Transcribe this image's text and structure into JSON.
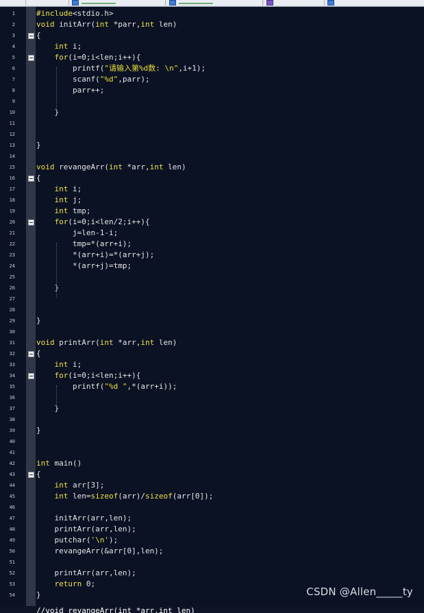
{
  "editor": {
    "lines": [
      {
        "n": "1",
        "text": "#include<stdio.h>",
        "fold": false
      },
      {
        "n": "2",
        "text": "void initArr(int *parr,int len)",
        "fold": false
      },
      {
        "n": "3",
        "text": "{",
        "fold": true
      },
      {
        "n": "4",
        "text": "    int i;",
        "fold": false
      },
      {
        "n": "5",
        "text": "    for(i=0;i<len;i++){",
        "fold": true
      },
      {
        "n": "6",
        "text": "        printf(\"请输入第%d数: \\n\",i+1);",
        "fold": false
      },
      {
        "n": "7",
        "text": "        scanf(\"%d\",parr);",
        "fold": false
      },
      {
        "n": "8",
        "text": "        parr++;",
        "fold": false
      },
      {
        "n": "9",
        "text": "",
        "fold": false
      },
      {
        "n": "10",
        "text": "    }",
        "fold": false
      },
      {
        "n": "11",
        "text": "",
        "fold": false
      },
      {
        "n": "12",
        "text": "",
        "fold": false
      },
      {
        "n": "13",
        "text": "}",
        "fold": false
      },
      {
        "n": "14",
        "text": "",
        "fold": false
      },
      {
        "n": "15",
        "text": "void revangeArr(int *arr,int len)",
        "fold": false
      },
      {
        "n": "16",
        "text": "{",
        "fold": true
      },
      {
        "n": "17",
        "text": "    int i;",
        "fold": false
      },
      {
        "n": "18",
        "text": "    int j;",
        "fold": false
      },
      {
        "n": "19",
        "text": "    int tmp;",
        "fold": false
      },
      {
        "n": "20",
        "text": "    for(i=0;i<len/2;i++){",
        "fold": true
      },
      {
        "n": "21",
        "text": "        j=len-1-i;",
        "fold": false
      },
      {
        "n": "22",
        "text": "        tmp=*(arr+i);",
        "fold": false
      },
      {
        "n": "23",
        "text": "        *(arr+i)=*(arr+j);",
        "fold": false
      },
      {
        "n": "24",
        "text": "        *(arr+j)=tmp;",
        "fold": false
      },
      {
        "n": "25",
        "text": "",
        "fold": false
      },
      {
        "n": "26",
        "text": "    }",
        "fold": false
      },
      {
        "n": "27",
        "text": "",
        "fold": false
      },
      {
        "n": "28",
        "text": "",
        "fold": false
      },
      {
        "n": "29",
        "text": "}",
        "fold": false
      },
      {
        "n": "30",
        "text": "",
        "fold": false
      },
      {
        "n": "31",
        "text": "void printArr(int *arr,int len)",
        "fold": false
      },
      {
        "n": "32",
        "text": "{",
        "fold": true
      },
      {
        "n": "33",
        "text": "    int i;",
        "fold": false
      },
      {
        "n": "34",
        "text": "    for(i=0;i<len;i++){",
        "fold": true
      },
      {
        "n": "35",
        "text": "        printf(\"%d \",*(arr+i));",
        "fold": false
      },
      {
        "n": "36",
        "text": "",
        "fold": false
      },
      {
        "n": "37",
        "text": "    }",
        "fold": false
      },
      {
        "n": "38",
        "text": "",
        "fold": false
      },
      {
        "n": "39",
        "text": "}",
        "fold": false
      },
      {
        "n": "40",
        "text": "",
        "fold": false
      },
      {
        "n": "41",
        "text": "",
        "fold": false
      },
      {
        "n": "42",
        "text": "int main()",
        "fold": false
      },
      {
        "n": "43",
        "text": "{",
        "fold": true
      },
      {
        "n": "44",
        "text": "    int arr[3];",
        "fold": false
      },
      {
        "n": "45",
        "text": "    int len=sizeof(arr)/sizeof(arr[0]);",
        "fold": false
      },
      {
        "n": "46",
        "text": "",
        "fold": false
      },
      {
        "n": "47",
        "text": "    initArr(arr,len);",
        "fold": false
      },
      {
        "n": "48",
        "text": "    printArr(arr,len);",
        "fold": false
      },
      {
        "n": "49",
        "text": "    putchar('\\n');",
        "fold": false
      },
      {
        "n": "50",
        "text": "    revangeArr(&arr[0],len);",
        "fold": false
      },
      {
        "n": "51",
        "text": "",
        "fold": false
      },
      {
        "n": "52",
        "text": "    printArr(arr,len);",
        "fold": false
      },
      {
        "n": "53",
        "text": "    return 0;",
        "fold": false
      },
      {
        "n": "54",
        "text": "}",
        "fold": false
      }
    ],
    "partial_last_line": "//void revangeArr(int *arr,int len)"
  },
  "watermark": "CSDN @Allen_____ty",
  "colors": {
    "background": "#0b1224",
    "code_text": "#e6e6e6",
    "keyword": "#f0e34a",
    "gutter_text": "#c7ccd6",
    "fold_margin": "#2b3243"
  }
}
